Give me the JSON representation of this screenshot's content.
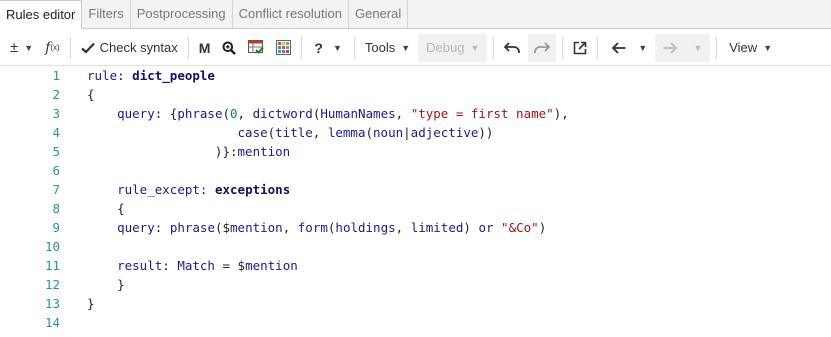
{
  "tabs": [
    {
      "label": "Rules editor",
      "active": true
    },
    {
      "label": "Filters",
      "active": false
    },
    {
      "label": "Postprocessing",
      "active": false
    },
    {
      "label": "Conflict resolution",
      "active": false
    },
    {
      "label": "General",
      "active": false
    }
  ],
  "toolbar": {
    "plusminus": "±",
    "fx": "f",
    "fx_sub": "(x)",
    "check_syntax": "Check syntax",
    "m_label": "M",
    "help": "?",
    "tools": "Tools",
    "debug": "Debug",
    "view": "View"
  },
  "code_lines": [
    {
      "n": "1",
      "text": "rule: dict_people"
    },
    {
      "n": "2",
      "text": "{"
    },
    {
      "n": "3",
      "text": "    query: {phrase(0, dictword(HumanNames, \"type = first name\"),"
    },
    {
      "n": "4",
      "text": "                    case(title, lemma(noun|adjective))"
    },
    {
      "n": "5",
      "text": "                 )}:mention"
    },
    {
      "n": "6",
      "text": ""
    },
    {
      "n": "7",
      "text": "    rule_except: exceptions"
    },
    {
      "n": "8",
      "text": "    {"
    },
    {
      "n": "9",
      "text": "    query: phrase($mention, form(holdings, limited) or \"&Co\")"
    },
    {
      "n": "10",
      "text": ""
    },
    {
      "n": "11",
      "text": "    result: Match = $mention"
    },
    {
      "n": "12",
      "text": "    }"
    },
    {
      "n": "13",
      "text": "}"
    },
    {
      "n": "14",
      "text": ""
    }
  ],
  "colors": {
    "line_number": "#2b8fb0",
    "keyword": "#1a1a8f",
    "string": "#a31515",
    "number": "#098658"
  }
}
